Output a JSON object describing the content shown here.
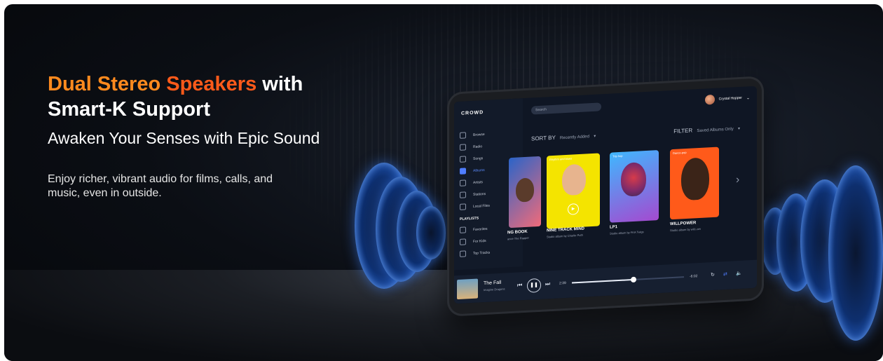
{
  "banner": {
    "headline": {
      "part1": "Dual Stereo",
      "part2": "Speakers",
      "part3": "with",
      "line2": "Smart-K Support"
    },
    "subhead": "Awaken Your Senses with Epic Sound",
    "body": "Enjoy richer, vibrant audio for films, calls, and music, even in outside."
  },
  "colors": {
    "accent_orange": "#ff8a1e",
    "accent_red_orange": "#ff5a1a",
    "speaker_blue": "#2f6fe0",
    "app_active_blue": "#4f7dff"
  },
  "tablet_app": {
    "logo": "CROWD",
    "search_placeholder": "Search",
    "user_name": "Crystal Hopper",
    "nav": [
      {
        "label": "Browse",
        "icon": "browse-icon"
      },
      {
        "label": "Radio",
        "icon": "radio-icon"
      },
      {
        "label": "Songs",
        "icon": "songs-icon"
      },
      {
        "label": "Albums",
        "icon": "albums-icon"
      },
      {
        "label": "Artists",
        "icon": "artists-icon"
      },
      {
        "label": "Stations",
        "icon": "stations-icon"
      },
      {
        "label": "Local Files",
        "icon": "folder-icon"
      }
    ],
    "playlists_heading": "PLAYLISTS",
    "playlists": [
      "Favorites",
      "For Kids",
      "Top Tracks"
    ],
    "sort_label": "SORT BY",
    "sort_value": "Recently Added",
    "filter_label": "FILTER",
    "filter_value": "Saved Albums Only",
    "albums": [
      {
        "title": "NG BOOK",
        "subtitle": "ance The Rapper",
        "tag": ""
      },
      {
        "title": "NINE TRACK MIND",
        "subtitle": "Studio album by Charlie Puth",
        "tag": "Rhythm and blues"
      },
      {
        "title": "LP1",
        "subtitle": "Studio album by FKA Twigs",
        "tag": "Trip hop"
      },
      {
        "title": "WILLPOWER",
        "subtitle": "Studio album by will.i.am",
        "tag": "Dance-pop"
      }
    ],
    "player": {
      "track": "The Fall",
      "artist": "Imagine Dragons",
      "elapsed": "2:39",
      "remaining": "-6:02",
      "progress": 0.55
    }
  }
}
